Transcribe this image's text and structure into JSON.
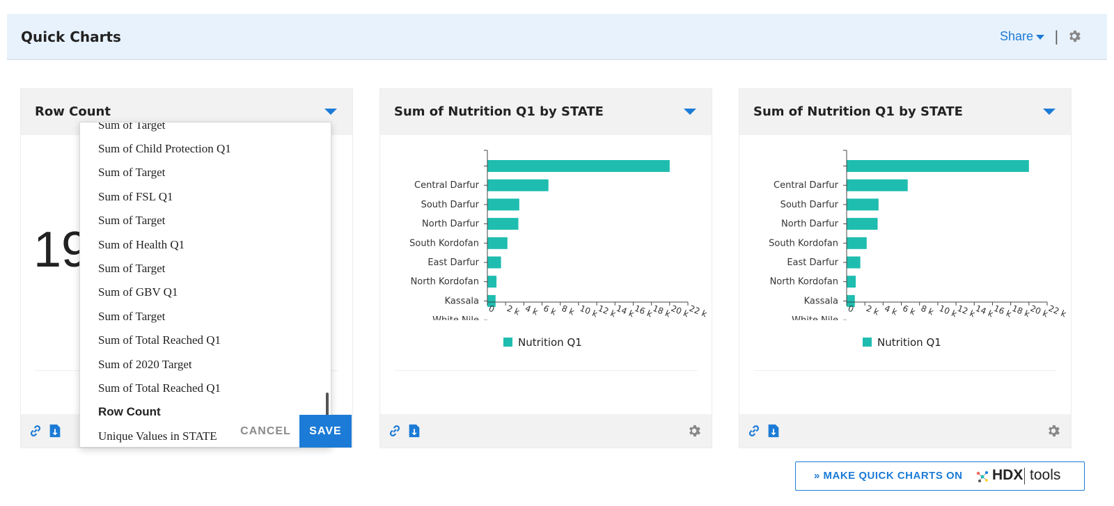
{
  "header": {
    "title": "Quick Charts",
    "share_label": "Share"
  },
  "cards": [
    {
      "title": "Row Count",
      "big_value": "19"
    },
    {
      "title": "Sum of Nutrition Q1 by STATE",
      "legend": "Nutrition Q1"
    },
    {
      "title": "Sum of Nutrition Q1 by STATE",
      "legend": "Nutrition Q1"
    }
  ],
  "dropdown": {
    "items": [
      "Sum of Target",
      "Sum of Child Protection Q1",
      "Sum of Target",
      "Sum of FSL Q1",
      "Sum of Target",
      "Sum of Health Q1",
      "Sum of Target",
      "Sum of GBV Q1",
      "Sum of Target",
      "Sum of Total Reached Q1",
      "Sum of 2020 Target",
      "Sum of Total Reached Q1",
      "Row Count",
      "Unique Values in STATE"
    ],
    "selected": "Row Count",
    "cancel_label": "CANCEL",
    "save_label": "SAVE"
  },
  "footer_button": {
    "label": "» MAKE QUICK CHARTS ON",
    "brand": "HDX",
    "brand_suffix": "tools"
  },
  "colors": {
    "accent": "#1c7bd6",
    "bar": "#1ebdaf",
    "header_bg": "#e8f2fc"
  },
  "chart_data": [
    {
      "type": "bar",
      "orientation": "horizontal",
      "title": "Sum of Nutrition Q1 by STATE",
      "categories": [
        "",
        "Central Darfur",
        "South Darfur",
        "North Darfur",
        "South Kordofan",
        "East Darfur",
        "North Kordofan",
        "Kassala",
        "White Nile"
      ],
      "series": [
        {
          "name": "Nutrition Q1",
          "values": [
            20000,
            6700,
            3500,
            3400,
            2200,
            1500,
            1000,
            900,
            0
          ]
        }
      ],
      "xticks": [
        "0",
        "2 k",
        "4 k",
        "6 k",
        "8 k",
        "10 k",
        "12 k",
        "14 k",
        "16 k",
        "18 k",
        "20 k",
        "22 k"
      ],
      "xlim": [
        0,
        22000
      ],
      "legend": "bottom",
      "grid": false
    },
    {
      "type": "bar",
      "orientation": "horizontal",
      "title": "Sum of Nutrition Q1 by STATE",
      "categories": [
        "",
        "Central Darfur",
        "South Darfur",
        "North Darfur",
        "South Kordofan",
        "East Darfur",
        "North Kordofan",
        "Kassala",
        "White Nile"
      ],
      "series": [
        {
          "name": "Nutrition Q1",
          "values": [
            20000,
            6700,
            3500,
            3400,
            2200,
            1500,
            1000,
            900,
            0
          ]
        }
      ],
      "xticks": [
        "0",
        "2 k",
        "4 k",
        "6 k",
        "8 k",
        "10 k",
        "12 k",
        "14 k",
        "16 k",
        "18 k",
        "20 k",
        "22 k"
      ],
      "xlim": [
        0,
        22000
      ],
      "legend": "bottom",
      "grid": false
    }
  ]
}
